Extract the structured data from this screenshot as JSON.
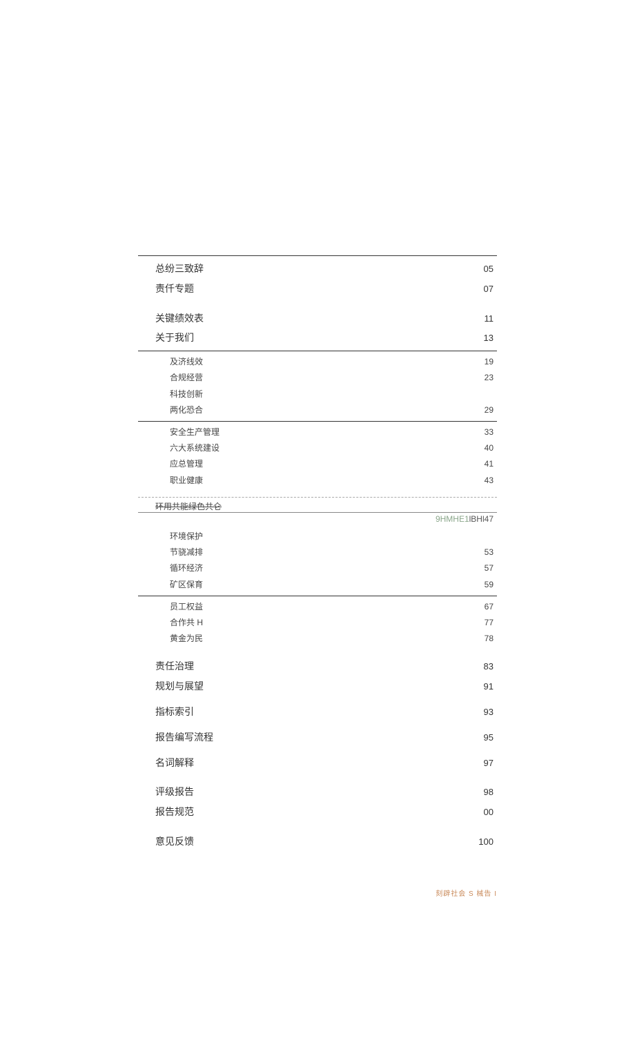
{
  "sections": [
    {
      "type": "major",
      "border": true,
      "rows": [
        {
          "label": "总纷三致辞",
          "page": "05",
          "level": "top"
        },
        {
          "label": "责仟专题",
          "page": "07",
          "level": "top"
        }
      ]
    },
    {
      "type": "major",
      "border": false,
      "gap": true,
      "rows": [
        {
          "label": "关键绩效表",
          "page": "11",
          "level": "top"
        },
        {
          "label": "关于我们",
          "page": "13",
          "level": "top"
        }
      ]
    },
    {
      "type": "sub",
      "border": true,
      "rows": [
        {
          "label": "及济线效",
          "page": "19",
          "level": "sub"
        },
        {
          "label": "合规经营",
          "page": "23",
          "level": "sub"
        },
        {
          "label": "科技创新",
          "page": "",
          "level": "sub"
        },
        {
          "label": "两化恐合",
          "page": "29",
          "level": "sub"
        }
      ]
    },
    {
      "type": "sub",
      "border": true,
      "rows": [
        {
          "label": "安全生产管理",
          "page": "33",
          "level": "sub"
        },
        {
          "label": "六大系统建设",
          "page": "40",
          "level": "sub"
        },
        {
          "label": "应总管理",
          "page": "41",
          "level": "sub"
        },
        {
          "label": "职业健康",
          "page": "43",
          "level": "sub"
        }
      ]
    },
    {
      "type": "heading",
      "heading": "环用共能绿色共仑",
      "special_code": {
        "green": "9HMHE1",
        "dark": "lBHl47"
      },
      "rows": [
        {
          "label": "环境保护",
          "page": "",
          "level": "sub"
        },
        {
          "label": "节骁减排",
          "page": "53",
          "level": "sub"
        },
        {
          "label": "循环经济",
          "page": "57",
          "level": "sub"
        },
        {
          "label": "矿区保育",
          "page": "59",
          "level": "sub"
        }
      ]
    },
    {
      "type": "sub",
      "border": true,
      "rows": [
        {
          "label": "员工权益",
          "page": "67",
          "level": "sub"
        },
        {
          "label": "合作共 H",
          "page": "77",
          "level": "sub"
        },
        {
          "label": "黄金为民",
          "page": "78",
          "level": "sub"
        }
      ]
    },
    {
      "type": "major",
      "border": false,
      "gap": true,
      "rows": [
        {
          "label": "责任治理",
          "page": "83",
          "level": "top"
        },
        {
          "label": "规划与展望",
          "page": "91",
          "level": "top"
        }
      ]
    },
    {
      "type": "major",
      "border": false,
      "rows": [
        {
          "label": "指标索引",
          "page": "93",
          "level": "top"
        }
      ]
    },
    {
      "type": "major",
      "border": false,
      "rows": [
        {
          "label": "报告编写流程",
          "page": "95",
          "level": "top"
        }
      ]
    },
    {
      "type": "major",
      "border": false,
      "rows": [
        {
          "label": "名词解释",
          "page": "97",
          "level": "top"
        }
      ]
    },
    {
      "type": "major",
      "border": false,
      "gap": true,
      "rows": [
        {
          "label": "评级报告",
          "page": "98",
          "level": "top"
        },
        {
          "label": "报告规范",
          "page": "00",
          "level": "top"
        }
      ]
    },
    {
      "type": "major",
      "border": false,
      "gap": true,
      "rows": [
        {
          "label": "意见反馈",
          "page": "100",
          "level": "top"
        }
      ]
    }
  ],
  "footer": "刻辟社会 S 械告 I"
}
